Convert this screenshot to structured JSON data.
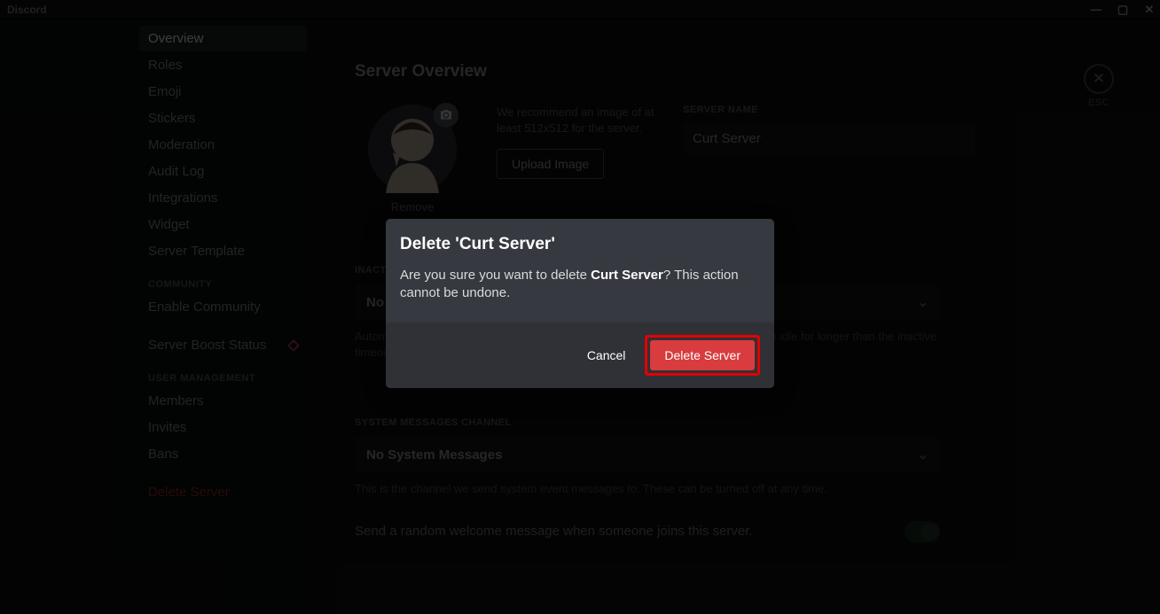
{
  "window": {
    "title": "Discord"
  },
  "sidebar": {
    "items": [
      "Overview",
      "Roles",
      "Emoji",
      "Stickers",
      "Moderation",
      "Audit Log",
      "Integrations",
      "Widget",
      "Server Template"
    ],
    "community_header": "Community",
    "community_items": [
      "Enable Community"
    ],
    "boost_item": "Server Boost Status",
    "user_mgmt_header": "User Management",
    "user_mgmt_items": [
      "Members",
      "Invites",
      "Bans"
    ],
    "delete_item": "Delete Server"
  },
  "content": {
    "title": "Server Overview",
    "upload_hint": "We recommend an image of at least 512x512 for the server.",
    "upload_button": "Upload Image",
    "remove_label": "Remove",
    "server_name_label": "Server Name",
    "server_name_value": "Curt Server",
    "inactive_label": "Inactive Channel",
    "inactive_value": "No Inactive Channel",
    "inactive_help": "Automatically move members to this channel and mute them when they have been idle for longer than the inactive timeout.",
    "sysmsg_label": "System Messages Channel",
    "sysmsg_value": "No System Messages",
    "sysmsg_help": "This is the channel we send system event messages to. These can be turned off at any time.",
    "welcome_toggle_label": "Send a random welcome message when someone joins this server.",
    "esc_label": "ESC"
  },
  "modal": {
    "title": "Delete 'Curt Server'",
    "text_lead": "Are you sure you want to delete ",
    "text_strong": "Curt Server",
    "text_tail": "? This action cannot be undone.",
    "cancel": "Cancel",
    "confirm": "Delete Server"
  }
}
